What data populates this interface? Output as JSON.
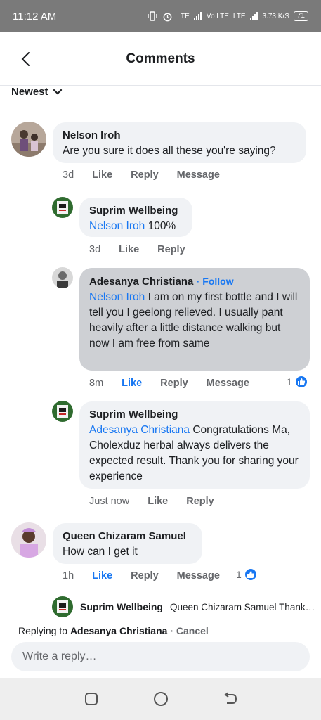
{
  "status_bar": {
    "time": "11:12 AM",
    "signal_text": "LTE",
    "volte": "Vo LTE",
    "speed": "3.73 K/S",
    "battery": "71"
  },
  "header": {
    "title": "Comments"
  },
  "sort": {
    "label": "Newest"
  },
  "comments": [
    {
      "author": "Nelson Iroh",
      "text": "Are you sure it does all these you're saying?",
      "time": "3d",
      "like": "Like",
      "reply": "Reply",
      "message": "Message"
    },
    {
      "author": "Suprim Wellbeing",
      "mention": "Nelson Iroh",
      "text": " 100%",
      "time": "3d",
      "like": "Like",
      "reply": "Reply"
    },
    {
      "author": "Adesanya Christiana",
      "follow": "Follow",
      "mention": "Nelson Iroh",
      "text": " I am on my first bottle and I will tell you I geelong relieved. I usually pant heavily after a  little distance walking but now I am free from same",
      "time": "8m",
      "like": "Like",
      "reply": "Reply",
      "message": "Message",
      "reactions": "1"
    },
    {
      "author": "Suprim Wellbeing",
      "mention": "Adesanya Christiana",
      "text": " Congratulations Ma, Cholexduz herbal always delivers the expected result. Thank you for sharing your experience",
      "time": "Just now",
      "like": "Like",
      "reply": "Reply"
    },
    {
      "author": "Queen Chizaram Samuel",
      "text": "How can I get it",
      "time": "1h",
      "like": "Like",
      "reply": "Reply",
      "message": "Message",
      "reactions": "1"
    }
  ],
  "reply_preview": {
    "author": "Suprim Wellbeing",
    "text": "Queen Chizaram Samuel Thank…"
  },
  "reply_bar": {
    "prefix": "Replying to",
    "target": "Adesanya Christiana",
    "separator": "·",
    "cancel": "Cancel",
    "placeholder": "Write a reply…"
  },
  "colors": {
    "accent": "#1877f2",
    "bubble": "#f0f2f5",
    "bubble_selected": "#ced0d4",
    "status_bar": "#7a7a7a"
  }
}
